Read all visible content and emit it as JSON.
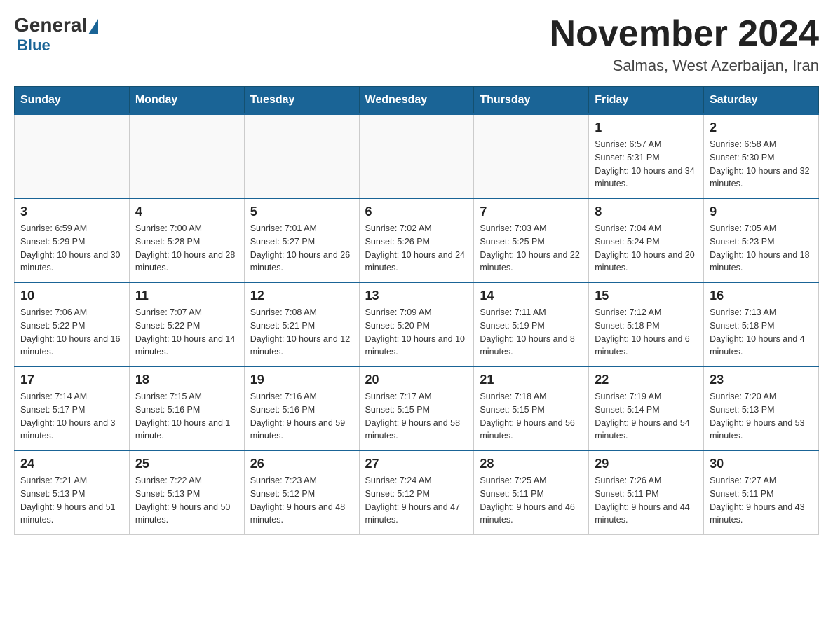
{
  "header": {
    "logo_general": "General",
    "logo_blue": "Blue",
    "month_title": "November 2024",
    "location": "Salmas, West Azerbaijan, Iran"
  },
  "days_of_week": [
    "Sunday",
    "Monday",
    "Tuesday",
    "Wednesday",
    "Thursday",
    "Friday",
    "Saturday"
  ],
  "weeks": [
    [
      {
        "day": "",
        "info": ""
      },
      {
        "day": "",
        "info": ""
      },
      {
        "day": "",
        "info": ""
      },
      {
        "day": "",
        "info": ""
      },
      {
        "day": "",
        "info": ""
      },
      {
        "day": "1",
        "info": "Sunrise: 6:57 AM\nSunset: 5:31 PM\nDaylight: 10 hours and 34 minutes."
      },
      {
        "day": "2",
        "info": "Sunrise: 6:58 AM\nSunset: 5:30 PM\nDaylight: 10 hours and 32 minutes."
      }
    ],
    [
      {
        "day": "3",
        "info": "Sunrise: 6:59 AM\nSunset: 5:29 PM\nDaylight: 10 hours and 30 minutes."
      },
      {
        "day": "4",
        "info": "Sunrise: 7:00 AM\nSunset: 5:28 PM\nDaylight: 10 hours and 28 minutes."
      },
      {
        "day": "5",
        "info": "Sunrise: 7:01 AM\nSunset: 5:27 PM\nDaylight: 10 hours and 26 minutes."
      },
      {
        "day": "6",
        "info": "Sunrise: 7:02 AM\nSunset: 5:26 PM\nDaylight: 10 hours and 24 minutes."
      },
      {
        "day": "7",
        "info": "Sunrise: 7:03 AM\nSunset: 5:25 PM\nDaylight: 10 hours and 22 minutes."
      },
      {
        "day": "8",
        "info": "Sunrise: 7:04 AM\nSunset: 5:24 PM\nDaylight: 10 hours and 20 minutes."
      },
      {
        "day": "9",
        "info": "Sunrise: 7:05 AM\nSunset: 5:23 PM\nDaylight: 10 hours and 18 minutes."
      }
    ],
    [
      {
        "day": "10",
        "info": "Sunrise: 7:06 AM\nSunset: 5:22 PM\nDaylight: 10 hours and 16 minutes."
      },
      {
        "day": "11",
        "info": "Sunrise: 7:07 AM\nSunset: 5:22 PM\nDaylight: 10 hours and 14 minutes."
      },
      {
        "day": "12",
        "info": "Sunrise: 7:08 AM\nSunset: 5:21 PM\nDaylight: 10 hours and 12 minutes."
      },
      {
        "day": "13",
        "info": "Sunrise: 7:09 AM\nSunset: 5:20 PM\nDaylight: 10 hours and 10 minutes."
      },
      {
        "day": "14",
        "info": "Sunrise: 7:11 AM\nSunset: 5:19 PM\nDaylight: 10 hours and 8 minutes."
      },
      {
        "day": "15",
        "info": "Sunrise: 7:12 AM\nSunset: 5:18 PM\nDaylight: 10 hours and 6 minutes."
      },
      {
        "day": "16",
        "info": "Sunrise: 7:13 AM\nSunset: 5:18 PM\nDaylight: 10 hours and 4 minutes."
      }
    ],
    [
      {
        "day": "17",
        "info": "Sunrise: 7:14 AM\nSunset: 5:17 PM\nDaylight: 10 hours and 3 minutes."
      },
      {
        "day": "18",
        "info": "Sunrise: 7:15 AM\nSunset: 5:16 PM\nDaylight: 10 hours and 1 minute."
      },
      {
        "day": "19",
        "info": "Sunrise: 7:16 AM\nSunset: 5:16 PM\nDaylight: 9 hours and 59 minutes."
      },
      {
        "day": "20",
        "info": "Sunrise: 7:17 AM\nSunset: 5:15 PM\nDaylight: 9 hours and 58 minutes."
      },
      {
        "day": "21",
        "info": "Sunrise: 7:18 AM\nSunset: 5:15 PM\nDaylight: 9 hours and 56 minutes."
      },
      {
        "day": "22",
        "info": "Sunrise: 7:19 AM\nSunset: 5:14 PM\nDaylight: 9 hours and 54 minutes."
      },
      {
        "day": "23",
        "info": "Sunrise: 7:20 AM\nSunset: 5:13 PM\nDaylight: 9 hours and 53 minutes."
      }
    ],
    [
      {
        "day": "24",
        "info": "Sunrise: 7:21 AM\nSunset: 5:13 PM\nDaylight: 9 hours and 51 minutes."
      },
      {
        "day": "25",
        "info": "Sunrise: 7:22 AM\nSunset: 5:13 PM\nDaylight: 9 hours and 50 minutes."
      },
      {
        "day": "26",
        "info": "Sunrise: 7:23 AM\nSunset: 5:12 PM\nDaylight: 9 hours and 48 minutes."
      },
      {
        "day": "27",
        "info": "Sunrise: 7:24 AM\nSunset: 5:12 PM\nDaylight: 9 hours and 47 minutes."
      },
      {
        "day": "28",
        "info": "Sunrise: 7:25 AM\nSunset: 5:11 PM\nDaylight: 9 hours and 46 minutes."
      },
      {
        "day": "29",
        "info": "Sunrise: 7:26 AM\nSunset: 5:11 PM\nDaylight: 9 hours and 44 minutes."
      },
      {
        "day": "30",
        "info": "Sunrise: 7:27 AM\nSunset: 5:11 PM\nDaylight: 9 hours and 43 minutes."
      }
    ]
  ]
}
